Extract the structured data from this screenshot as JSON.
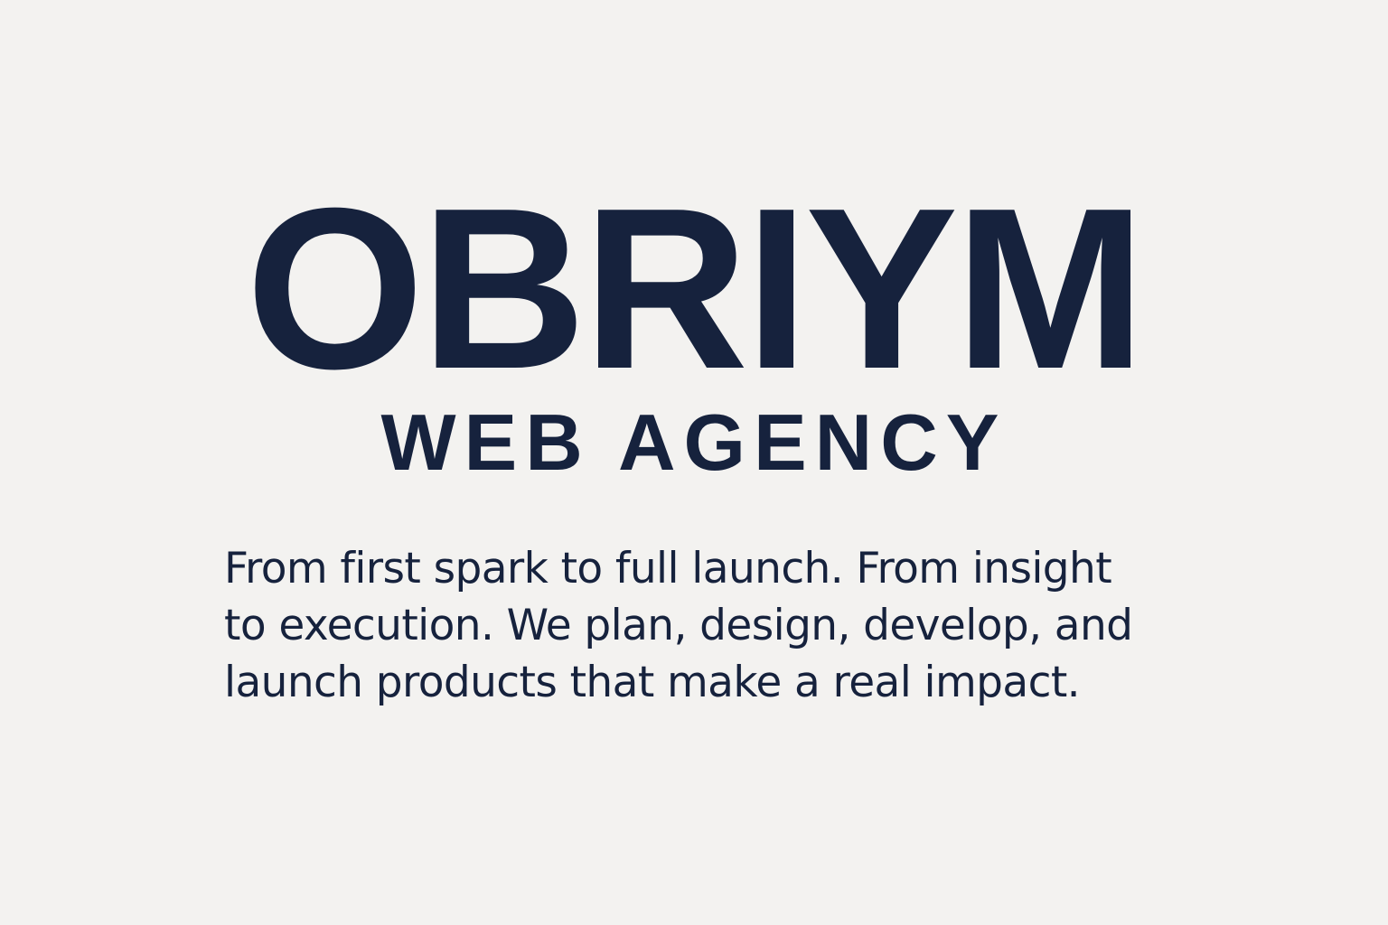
{
  "brand": {
    "name": "OBRIYM",
    "subtitle": "WEB AGENCY"
  },
  "tagline": {
    "lines": [
      "From first spark to full launch. From insight",
      "to execution. We plan, design, develop, and",
      "launch products that make a real impact."
    ]
  },
  "colors": {
    "background": "#f3f2f0",
    "text": "#16223d"
  }
}
